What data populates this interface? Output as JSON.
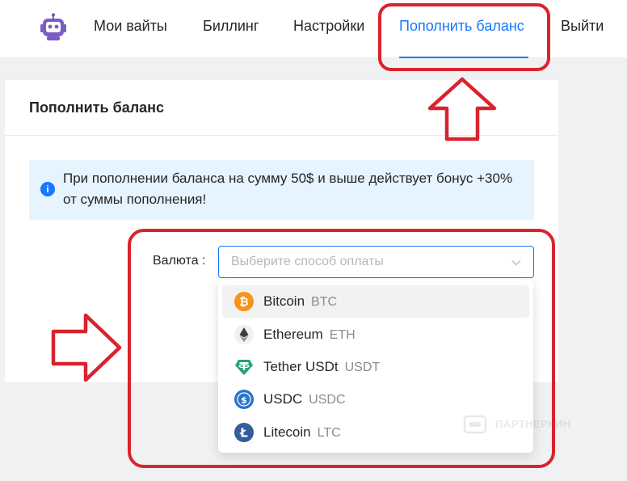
{
  "nav": {
    "logo_icon": "robot-icon",
    "items": [
      {
        "label": "Мои вайты"
      },
      {
        "label": "Биллинг"
      },
      {
        "label": "Настройки"
      },
      {
        "label": "Пополнить баланс",
        "active": true
      },
      {
        "label": "Выйти"
      }
    ]
  },
  "card": {
    "title": "Пополнить баланс",
    "alert": {
      "icon": "info-icon",
      "text": "При пополнении баланса на сумму 50$ и выше действует бонус +30% от суммы пополнения!"
    },
    "currency": {
      "label": "Валюта :",
      "placeholder": "Выберите способ оплаты",
      "arrow_icon": "chevron-down-icon"
    }
  },
  "dropdown": {
    "options": [
      {
        "name": "Bitcoin",
        "code": "BTC",
        "icon": "bitcoin-icon",
        "color": "#f7931a"
      },
      {
        "name": "Ethereum",
        "code": "ETH",
        "icon": "ethereum-icon",
        "color": "#3c3c3d"
      },
      {
        "name": "Tether USDt",
        "code": "USDT",
        "icon": "tether-icon",
        "color": "#26a17b"
      },
      {
        "name": "USDC",
        "code": "USDC",
        "icon": "usdc-icon",
        "color": "#2775ca"
      },
      {
        "name": "Litecoin",
        "code": "LTC",
        "icon": "litecoin-icon",
        "color": "#345d9d"
      }
    ]
  },
  "watermark": {
    "text": "ПАРТНЕРКИН"
  },
  "colors": {
    "accent": "#1677ff",
    "annotation": "#d9232d",
    "alert_bg": "#e6f4ff"
  }
}
